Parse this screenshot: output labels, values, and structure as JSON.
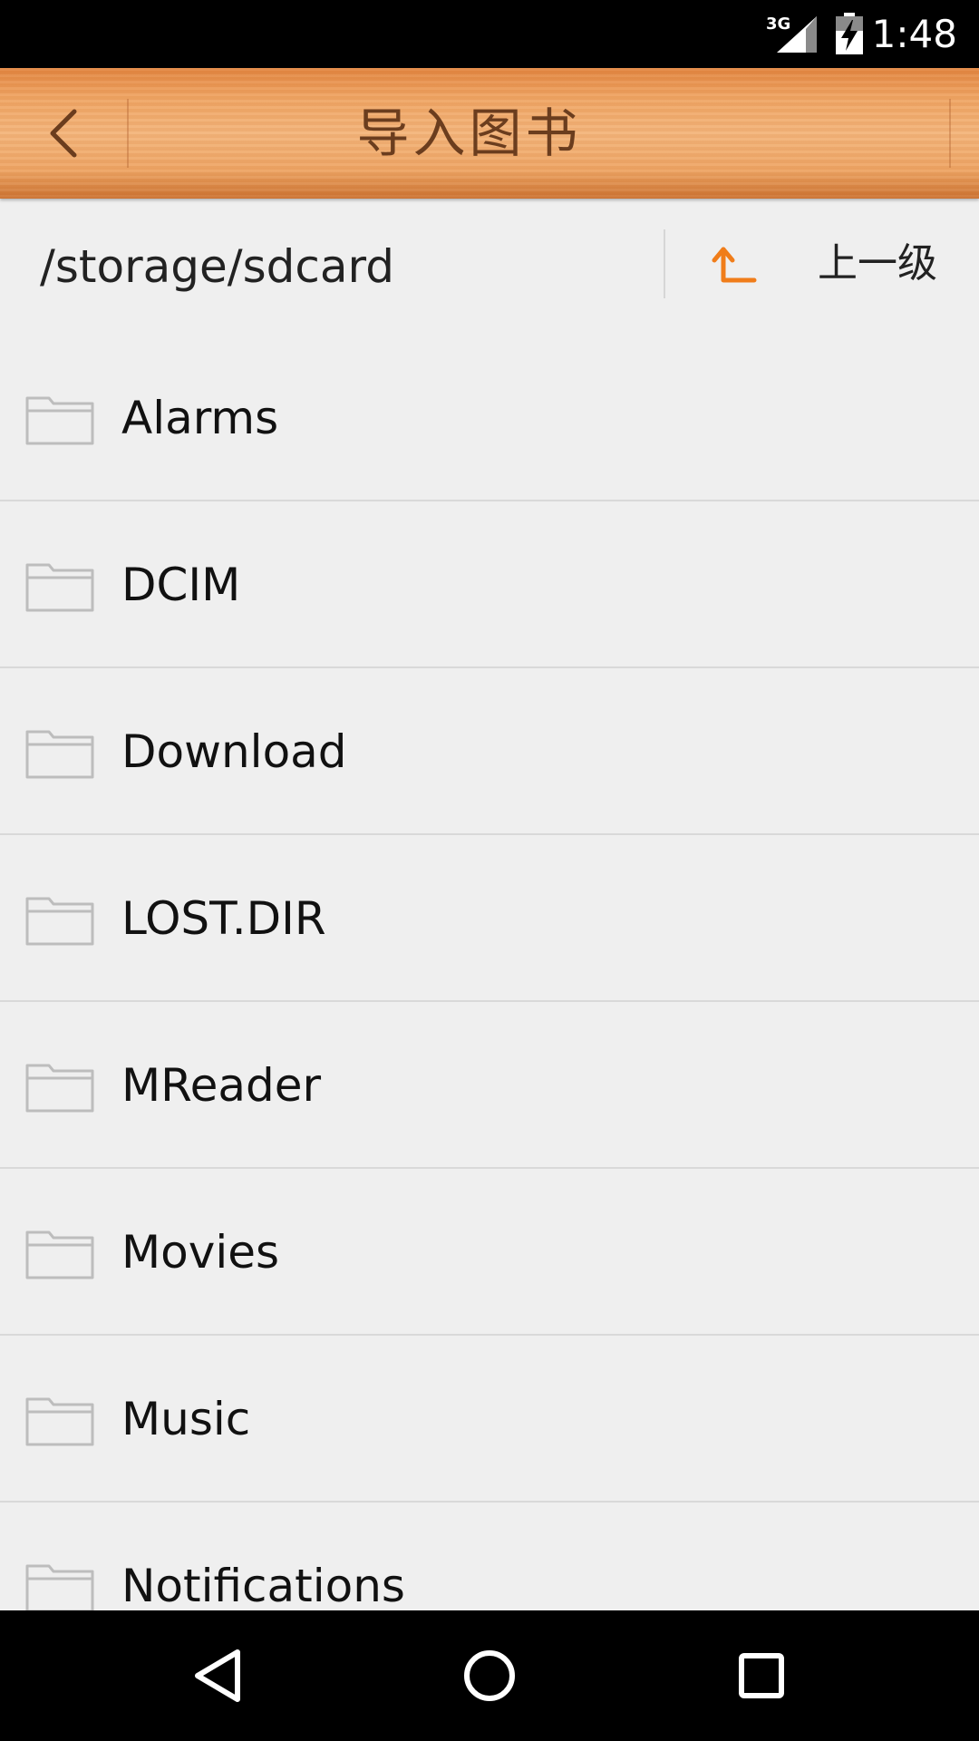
{
  "status_bar": {
    "network": "3G",
    "time": "1:48",
    "icons": [
      "signal-3g-icon",
      "battery-charging-icon"
    ]
  },
  "header": {
    "title": "导入图书",
    "back_icon": "chevron-left-icon"
  },
  "path_bar": {
    "current_path": "/storage/sdcard",
    "up_label": "上一级",
    "up_icon": "level-up-arrow-icon"
  },
  "files": {
    "items": [
      {
        "name": "Alarms",
        "icon": "folder-icon"
      },
      {
        "name": "DCIM",
        "icon": "folder-icon"
      },
      {
        "name": "Download",
        "icon": "folder-icon"
      },
      {
        "name": "LOST.DIR",
        "icon": "folder-icon"
      },
      {
        "name": "MReader",
        "icon": "folder-icon"
      },
      {
        "name": "Movies",
        "icon": "folder-icon"
      },
      {
        "name": "Music",
        "icon": "folder-icon"
      },
      {
        "name": "Notifications",
        "icon": "folder-icon"
      }
    ]
  },
  "nav_bar": {
    "buttons": [
      "nav-back-icon",
      "nav-home-icon",
      "nav-recents-icon"
    ]
  },
  "colors": {
    "accent": "#f07d1a",
    "title_text": "#6b3d1e",
    "background": "#efefef"
  }
}
